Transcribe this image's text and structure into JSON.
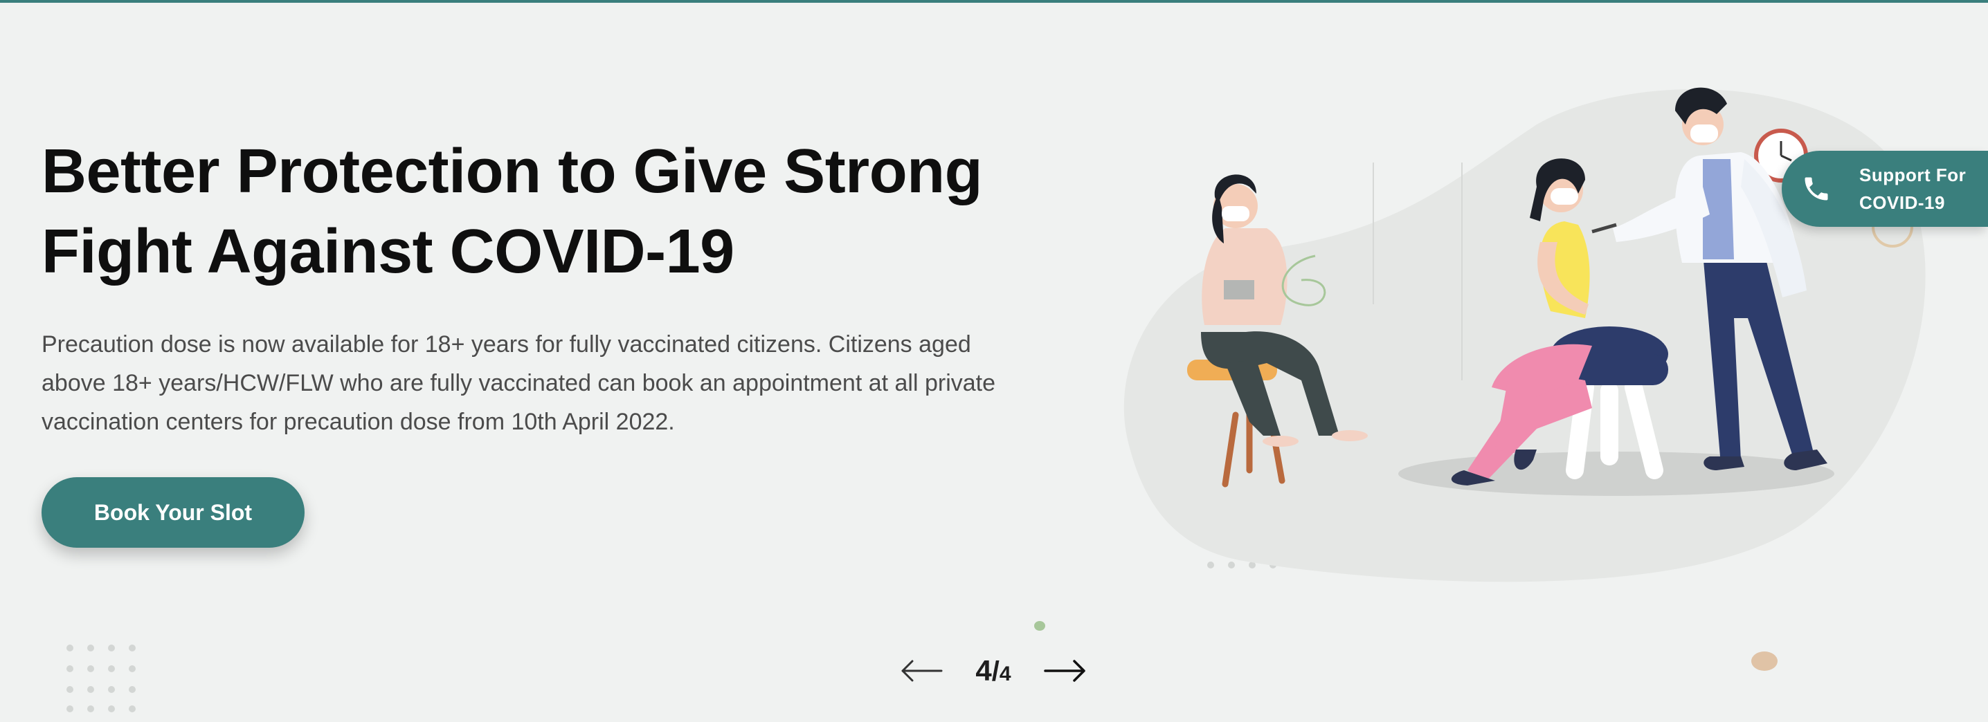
{
  "hero": {
    "title_line1": "Better Protection to Give Strong",
    "title_line2": "Fight Against COVID-19",
    "description": "Precaution dose is now available for 18+ years for fully vaccinated citizens. Citizens aged above 18+ years/HCW/FLW who are fully vaccinated can book an appointment at all private vaccination centers for precaution dose from 10th April 2022.",
    "cta_label": "Book Your Slot"
  },
  "slider": {
    "current": "4",
    "separator": "/",
    "total": "4",
    "prev_icon": "arrow-left-icon",
    "next_icon": "arrow-right-icon"
  },
  "support": {
    "line1": "Support For",
    "line2": "COVID-19",
    "icon": "phone-icon"
  },
  "colors": {
    "accent": "#3a7f7d",
    "background": "#f0f2f1",
    "title": "#0f0f0f",
    "body_text": "#4b4b4b"
  }
}
